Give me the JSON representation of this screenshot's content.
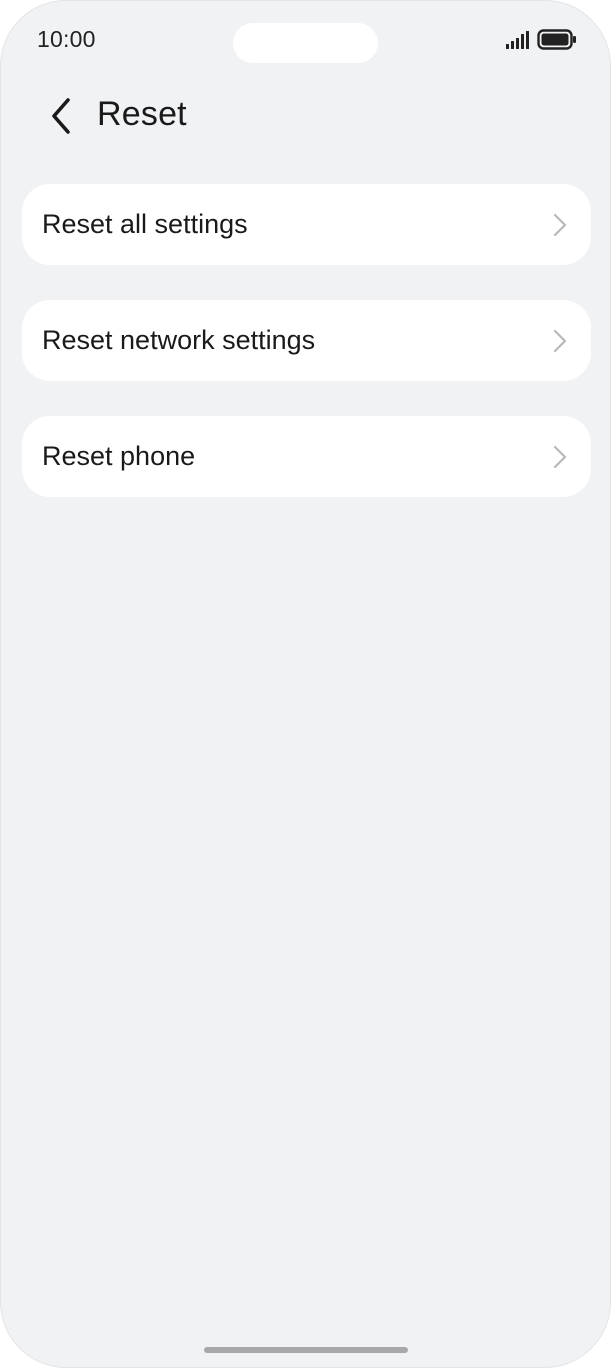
{
  "status_bar": {
    "time": "10:00",
    "icons": [
      "signal-icon",
      "battery-icon"
    ]
  },
  "header": {
    "back_icon": "chevron-left-icon",
    "title": "Reset"
  },
  "settings_list": {
    "items": [
      {
        "label": "Reset all settings",
        "icon": "chevron-right-icon"
      },
      {
        "label": "Reset network settings",
        "icon": "chevron-right-icon"
      },
      {
        "label": "Reset phone",
        "icon": "chevron-right-icon"
      }
    ]
  },
  "colors": {
    "background": "#f1f2f4",
    "card": "#ffffff",
    "text": "#1a1a1a",
    "chevron": "#b8b8ba",
    "home_indicator": "#a8a8aa"
  }
}
